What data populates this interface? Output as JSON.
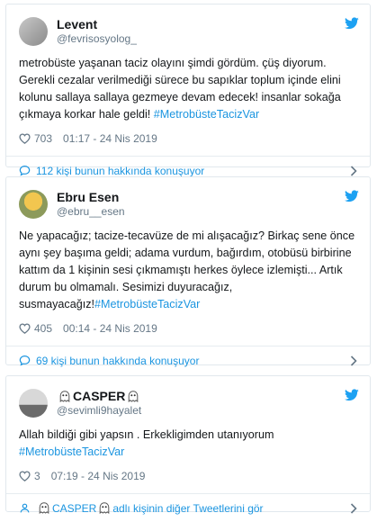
{
  "tweets": [
    {
      "name": "Levent",
      "handle": "@fevrisosyolog_",
      "text_main": "metrobüste yaşanan taciz olayını şimdi gördüm. çüş diyorum. Gerekli cezalar verilmediği sürece bu sapıklar toplum içinde elini kolunu sallaya sallaya gezmeye devam edecek! insanlar sokağa çıkmaya korkar hale geldi! ",
      "hashtag": "#MetrobüsteTacizVar",
      "likes": "703",
      "time": "01:17 - 24 Nis 2019",
      "footer": "112 kişi bunun hakkında konuşuyor"
    },
    {
      "name": "Ebru Esen",
      "handle": "@ebru__esen",
      "text_main": "Ne yapacağız; tacize-tecavüze de mi alışacağız? Birkaç sene önce aynı şey başıma geldi; adama vurdum, bağırdım, otobüsü birbirine kattım da 1 kişinin sesi çıkmamıştı herkes öylece izlemişti... Artık durum bu olmamalı. Sesimizi duyuracağız, susmayacağız!",
      "hashtag": "#MetrobüsteTacizVar",
      "likes": "405",
      "time": "00:14 - 24 Nis 2019",
      "footer": "69 kişi bunun hakkında konuşuyor"
    },
    {
      "name": "CASPER",
      "handle": "@sevimli9hayalet",
      "text_main": "Allah bildiği gibi yapsın . Erkekligimden utanıyorum\n",
      "hashtag": "#MetrobüsteTacizVar",
      "likes": "3",
      "time": "07:19 - 24 Nis 2019",
      "footer_pre": "CASPER",
      "footer": "adlı kişinin diğer Tweetlerini gör"
    }
  ],
  "icons": {
    "bird": "twitter-bird-icon",
    "heart": "heart-icon",
    "comment": "speech-bubble-icon",
    "person": "person-icon",
    "chevron": "chevron-right-icon",
    "ghost": "ghost-emoji-icon"
  },
  "colors": {
    "accent": "#1b95e0",
    "bird": "#1da1f2",
    "muted": "#657786",
    "border": "#e1e8ed"
  }
}
